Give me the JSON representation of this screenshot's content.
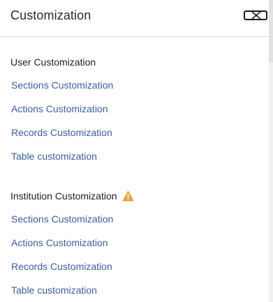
{
  "header": {
    "title": "Customization",
    "close_icon": "close-icon"
  },
  "user_customization": {
    "heading": "User Customization",
    "links": [
      "Sections Customization",
      "Actions Customization",
      "Records Customization",
      "Table customization"
    ]
  },
  "institution_customization": {
    "heading": "Institution Customization",
    "warning_icon": "warning-icon",
    "warning_color": "#e8a33d",
    "links": [
      "Sections Customization",
      "Actions Customization",
      "Records Customization",
      "Table customization"
    ]
  },
  "colors": {
    "link": "#3a5f9e",
    "title": "#2a2a2a",
    "divider": "#dcdcdc"
  }
}
